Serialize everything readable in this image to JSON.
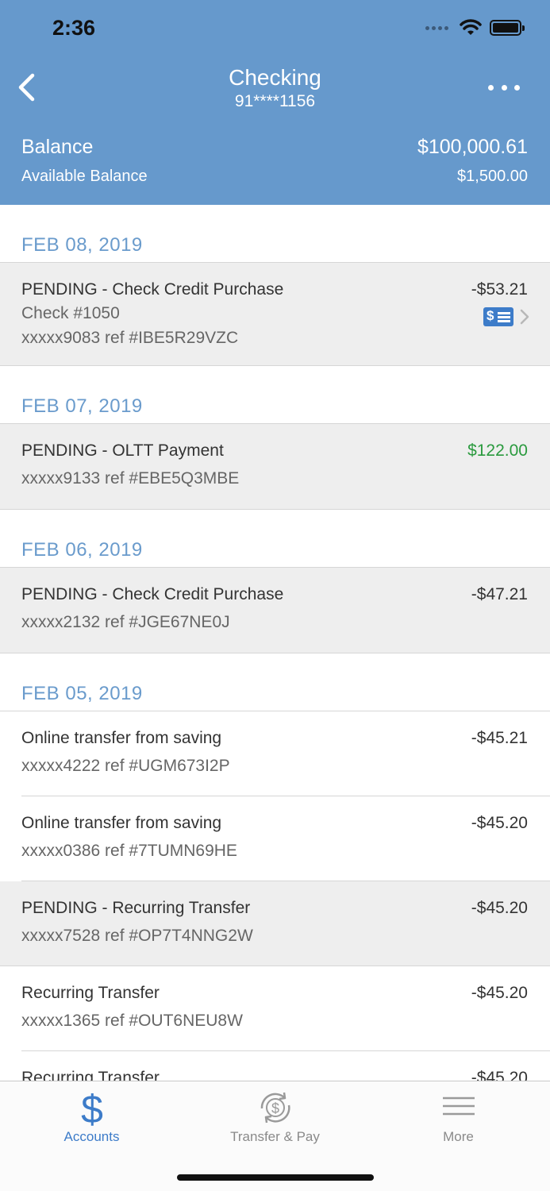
{
  "status": {
    "time": "2:36"
  },
  "header": {
    "title": "Checking",
    "account_number": "91****1156",
    "balance_label": "Balance",
    "balance_value": "$100,000.61",
    "available_label": "Available Balance",
    "available_value": "$1,500.00"
  },
  "groups": [
    {
      "date": "FEB 08, 2019",
      "transactions": [
        {
          "description": "PENDING - Check Credit Purchase",
          "check": "Check #1050",
          "reference": "xxxxx9083 ref #IBE5R29VZC",
          "amount": "-$53.21",
          "pending": true
        }
      ]
    },
    {
      "date": "FEB 07, 2019",
      "transactions": [
        {
          "description": "PENDING - OLTT Payment",
          "reference": "xxxxx9133 ref #EBE5Q3MBE",
          "amount": "$122.00",
          "pending": true
        }
      ]
    },
    {
      "date": "FEB 06, 2019",
      "transactions": [
        {
          "description": "PENDING - Check Credit Purchase",
          "reference": "xxxxx2132 ref #JGE67NE0J",
          "amount": "-$47.21",
          "pending": true
        }
      ]
    },
    {
      "date": "FEB 05, 2019",
      "transactions": [
        {
          "description": "Online transfer from saving",
          "reference": "xxxxx4222 ref #UGM673I2P",
          "amount": "-$45.21",
          "pending": false
        },
        {
          "description": "Online transfer from saving",
          "reference": "xxxxx0386 ref #7TUMN69HE",
          "amount": "-$45.20",
          "pending": false
        },
        {
          "description": "PENDING - Recurring Transfer",
          "reference": "xxxxx7528 ref #OP7T4NNG2W",
          "amount": "-$45.20",
          "pending": true
        },
        {
          "description": "Recurring Transfer",
          "reference": "xxxxx1365 ref #OUT6NEU8W",
          "amount": "-$45.20",
          "pending": false
        },
        {
          "description": "Recurring Transfer",
          "reference": "",
          "amount": "-$45.20",
          "pending": false
        }
      ]
    }
  ],
  "tabs": [
    {
      "label": "Accounts",
      "icon": "dollar-icon",
      "active": true
    },
    {
      "label": "Transfer & Pay",
      "icon": "transfer-pay-icon",
      "active": false
    },
    {
      "label": "More",
      "icon": "menu-icon",
      "active": false
    }
  ],
  "colors": {
    "header_bg": "#6699cc",
    "date_text": "#6a9bcc",
    "positive_amount": "#2a9a3e",
    "pending_bg": "#eeeeee",
    "tab_active": "#3d7cc9"
  }
}
